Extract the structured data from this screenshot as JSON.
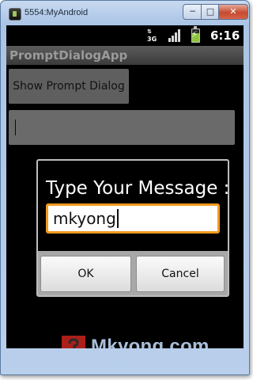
{
  "window": {
    "title": "5554:MyAndroid",
    "controls": {
      "minimize": "─",
      "maximize": "□",
      "close": "✕"
    }
  },
  "status_bar": {
    "network": "3G",
    "time": "6:16"
  },
  "app": {
    "title": "PromptDialogApp",
    "show_button_label": "Show Prompt Dialog",
    "result_value": ""
  },
  "dialog": {
    "message": "Type Your Message :",
    "input_value": "mkyong",
    "ok_label": "OK",
    "cancel_label": "Cancel"
  },
  "watermark": {
    "text": "Mkyong.com"
  },
  "colors": {
    "input_focus": "#f19a1e",
    "screen_background": "#000000",
    "logo_red": "#c9241f"
  }
}
